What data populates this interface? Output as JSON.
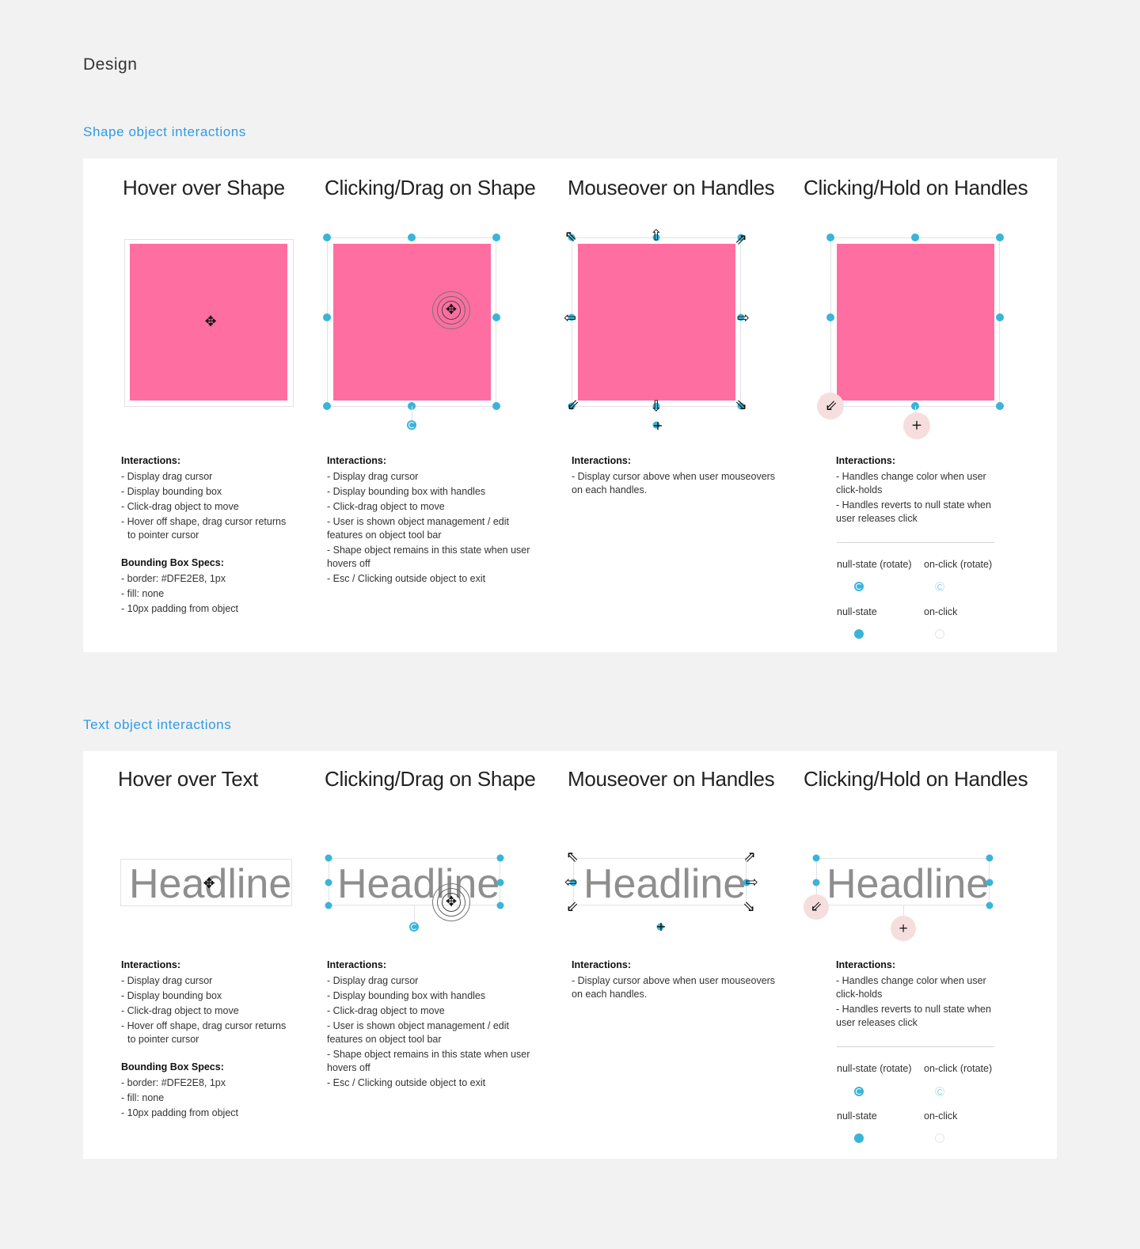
{
  "page": {
    "heading": "Design"
  },
  "colors": {
    "accent": "#2d9be8",
    "handle": "#3ab4d8",
    "shape_fill": "#ff6ea1",
    "bbox_border": "#DFE2E8",
    "hold_halo": "#f6dede"
  },
  "sections": [
    {
      "title": "Shape object interactions",
      "columns": [
        {
          "title": "Hover over Shape",
          "interactions_heading": "Interactions:",
          "interactions": [
            "- Display drag cursor",
            "- Display bounding box",
            "- Click-drag object to move",
            "- Hover off shape, drag cursor returns",
            "  to pointer cursor"
          ],
          "specs_heading": "Bounding Box Specs:",
          "specs": [
            "- border: #DFE2E8, 1px",
            "- fill: none",
            "- 10px padding from object"
          ]
        },
        {
          "title": "Clicking/Drag on Shape",
          "interactions_heading": "Interactions:",
          "interactions": [
            "- Display drag cursor",
            "- Display bounding box with handles",
            "- Click-drag object to move",
            "- User is shown object management / edit",
            "features on object tool bar",
            "- Shape object remains in this state when user",
            "hovers off",
            "- Esc / Clicking outside object to exit"
          ]
        },
        {
          "title": "Mouseover on Handles",
          "interactions_heading": "Interactions:",
          "interactions": [
            "- Display cursor above when user mouseovers",
            "on each handles."
          ]
        },
        {
          "title": "Clicking/Hold on Handles",
          "interactions_heading": "Interactions:",
          "interactions": [
            "- Handles change color when user",
            "click-holds",
            "- Handles reverts to null state when",
            "user releases click"
          ],
          "legend": {
            "null_rotate": "null-state (rotate)",
            "onclick_rotate": "on-click (rotate)",
            "null": "null-state",
            "onclick": "on-click"
          }
        }
      ]
    },
    {
      "title": "Text object interactions",
      "headline_text": "Headline",
      "columns": [
        {
          "title": "Hover over Text",
          "interactions_heading": "Interactions:",
          "interactions": [
            "- Display drag cursor",
            "- Display bounding box",
            "- Click-drag object to move",
            "- Hover off shape, drag cursor returns",
            "  to pointer cursor"
          ],
          "specs_heading": "Bounding Box Specs:",
          "specs": [
            "- border: #DFE2E8, 1px",
            "- fill: none",
            "- 10px padding from object"
          ]
        },
        {
          "title": "Clicking/Drag on Shape",
          "interactions_heading": "Interactions:",
          "interactions": [
            "- Display drag cursor",
            "- Display bounding box with handles",
            "- Click-drag object to move",
            "- User is shown object management / edit",
            "features on object tool bar",
            "- Shape object remains in this state when user",
            "hovers off",
            "- Esc / Clicking outside object to exit"
          ]
        },
        {
          "title": "Mouseover on Handles",
          "interactions_heading": "Interactions:",
          "interactions": [
            "- Display cursor above when user mouseovers",
            "on each handles."
          ]
        },
        {
          "title": "Clicking/Hold on Handles",
          "interactions_heading": "Interactions:",
          "interactions": [
            "- Handles change color when user",
            "click-holds",
            "- Handles reverts to null state when",
            "user releases click"
          ],
          "legend": {
            "null_rotate": "null-state (rotate)",
            "onclick_rotate": "on-click (rotate)",
            "null": "null-state",
            "onclick": "on-click"
          }
        }
      ]
    }
  ]
}
